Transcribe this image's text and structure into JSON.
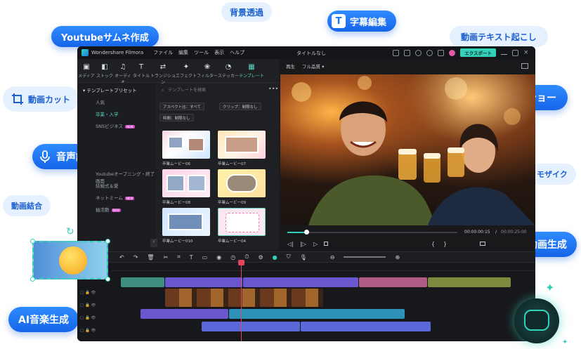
{
  "bubbles": {
    "youtube_thumb": "Youtubeサムネ作成",
    "bg_transparent": "背景透過",
    "subtitle_edit": "字幕編集",
    "video_to_text": "動画テキスト起こし",
    "video_cut": "動画カット",
    "slideshow": "スライドショー",
    "tts": "音声読み上げ",
    "mosaic": "モザイク",
    "video_merge": "動画結合",
    "ai_video": "AI 動画生成",
    "ai_music": "AI音楽生成"
  },
  "app": {
    "name": "Wondershare Filmora",
    "menu": [
      "ファイル",
      "編集",
      "ツール",
      "表示",
      "ヘルプ"
    ],
    "project_title": "タイトルなし",
    "export_label": "エクスポート"
  },
  "media_tabs": [
    "メディア",
    "ストック",
    "オーディオ",
    "タイトル",
    "トランジション",
    "エフェクト",
    "フィルター",
    "ステッカー",
    "テンプレート"
  ],
  "sidebar": {
    "header": "テンプレートプリセット",
    "items": [
      {
        "label": "人気",
        "badge": ""
      },
      {
        "label": "卒業・入学",
        "badge": ""
      },
      {
        "label": "SNSビジネス",
        "badge": "NEW"
      },
      {
        "label": "",
        "badge": ""
      },
      {
        "label": "",
        "badge": ""
      },
      {
        "label": "",
        "badge": ""
      },
      {
        "label": "Youtubeオープニング・終了画面",
        "badge": ""
      },
      {
        "label": "結婚式＆愛",
        "badge": ""
      },
      {
        "label": "ネットミーム",
        "badge": "NEW"
      },
      {
        "label": "抽活動",
        "badge": "NEW"
      }
    ]
  },
  "templates": {
    "search_placeholder": "テンプレートを検索",
    "filters": [
      "アスペクト比：すべて",
      "クリップ：制限なし",
      "時間：制限なし"
    ],
    "items": [
      "卒業ムービー06",
      "卒業ムービー07",
      "卒業ムービー08",
      "卒業ムービー09",
      "卒業ムービー010",
      "卒業ムービー04"
    ]
  },
  "preview": {
    "label": "再生",
    "quality": "フル品質",
    "current_time": "00:00:00:15",
    "total_time": "00:00:25:00",
    "progress": 0.11
  },
  "colors": {
    "accent": "#33d1b8",
    "bubble_blue": "#1e76ee",
    "playhead": "#e2455c"
  }
}
